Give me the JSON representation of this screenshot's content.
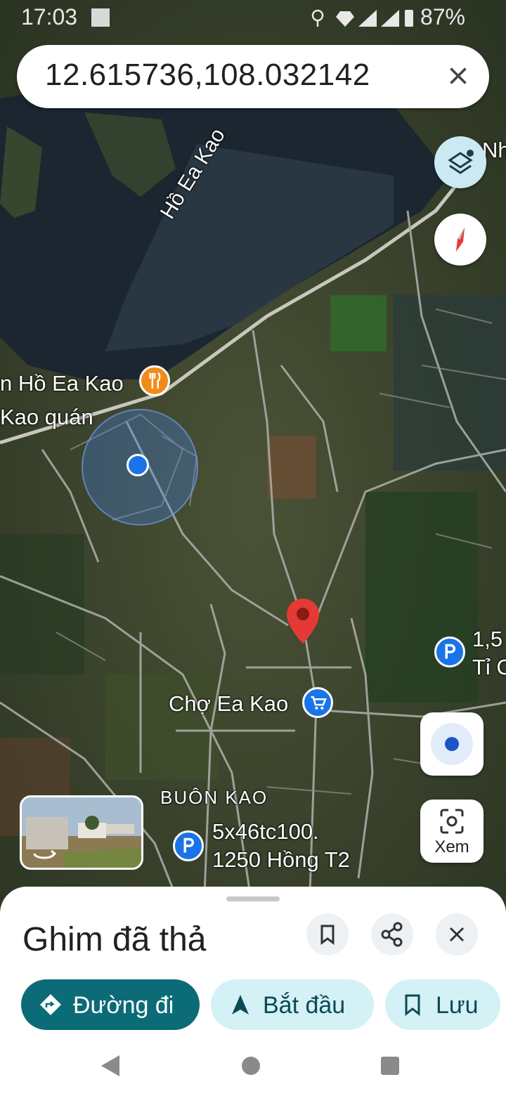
{
  "status": {
    "time": "17:03",
    "battery": "87%"
  },
  "search": {
    "query": "12.615736,108.032142"
  },
  "map": {
    "labels": {
      "lake": "Hồ Ea Kao",
      "restaurant_line1": "n Hồ Ea Kao",
      "restaurant_line2": "Kao quán",
      "market": "Chợ Ea Kao",
      "village": "BUÔN KAO",
      "parking1_line1": "5x46tc100.",
      "parking1_line2": "1250 Hồng T2",
      "parking2_line1": "1,5",
      "parking2_line2": "Tỉ C",
      "edge_top": "Nh"
    },
    "view_label": "Xem"
  },
  "sheet": {
    "title": "Ghim đã thả",
    "buttons": {
      "directions": "Đường đi",
      "start": "Bắt đầu",
      "save": "Lưu"
    }
  },
  "colors": {
    "accent_teal": "#0b6b76",
    "pill_bg": "#d4f1f6",
    "pin_red": "#e53935",
    "location_blue": "#1a73e8"
  }
}
